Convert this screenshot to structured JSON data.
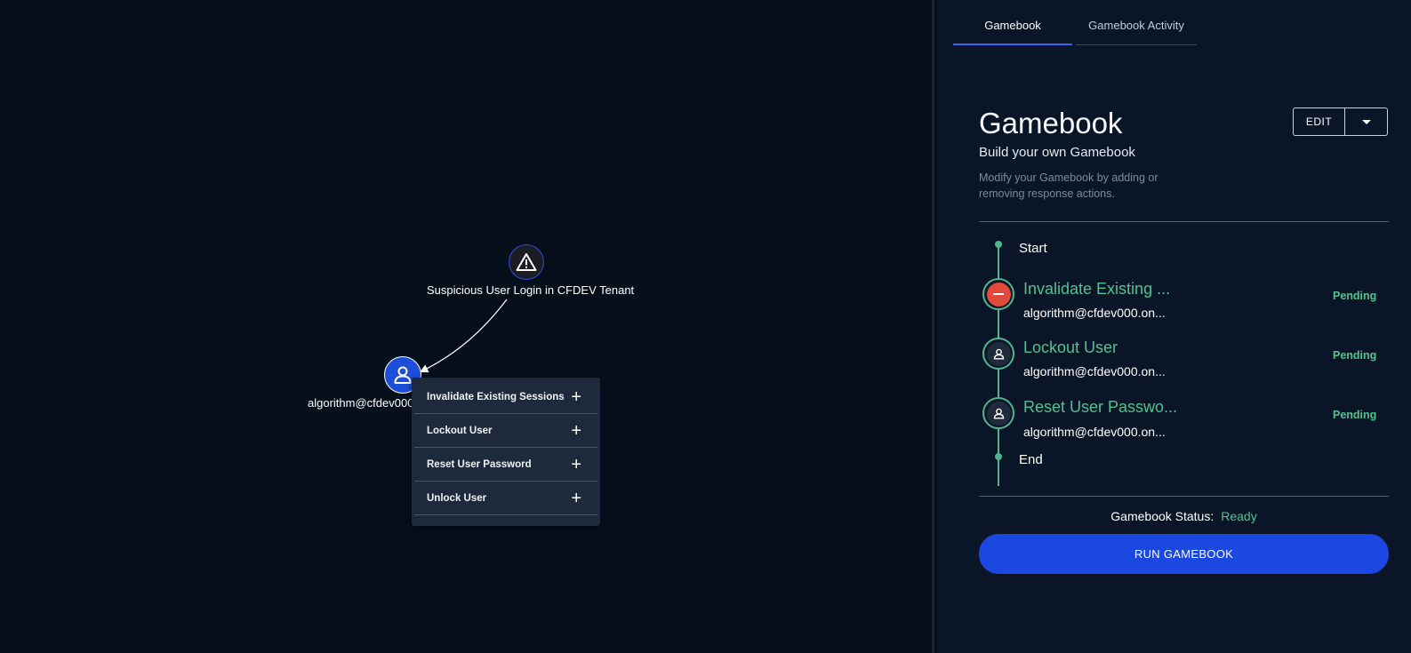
{
  "graph": {
    "alert_node": {
      "icon": "warning-icon",
      "label": "Suspicious User Login in CFDEV Tenant"
    },
    "user_node": {
      "icon": "user-icon",
      "label": "algorithm@cfdev000"
    },
    "context_menu": {
      "items": [
        {
          "label": "Invalidate Existing Sessions",
          "icon": "plus-icon"
        },
        {
          "label": "Lockout User",
          "icon": "plus-icon"
        },
        {
          "label": "Reset User Password",
          "icon": "plus-icon"
        },
        {
          "label": "Unlock User",
          "icon": "plus-icon"
        }
      ]
    }
  },
  "panel": {
    "tabs": [
      {
        "label": "Gamebook",
        "active": true
      },
      {
        "label": "Gamebook Activity",
        "active": false
      }
    ],
    "title": "Gamebook",
    "subtitle": "Build your own Gamebook",
    "description": "Modify your Gamebook by adding or removing response actions.",
    "edit_label": "EDIT",
    "timeline": {
      "start_label": "Start",
      "end_label": "End",
      "steps": [
        {
          "title": "Invalidate Existing ...",
          "target": "algorithm@cfdev000.on...",
          "status": "Pending",
          "icon": "minus-icon"
        },
        {
          "title": "Lockout User",
          "target": "algorithm@cfdev000.on...",
          "status": "Pending",
          "icon": "user-icon"
        },
        {
          "title": "Reset User Passwo...",
          "target": "algorithm@cfdev000.on...",
          "status": "Pending",
          "icon": "user-icon"
        }
      ]
    },
    "status_label": "Gamebook Status:",
    "status_value": "Ready",
    "run_label": "RUN GAMEBOOK"
  },
  "colors": {
    "accent": "#1a48e0",
    "success": "#4fc38e",
    "danger": "#e04a3b",
    "canvas_bg": "#050f1c",
    "panel_bg": "#0a1628"
  }
}
